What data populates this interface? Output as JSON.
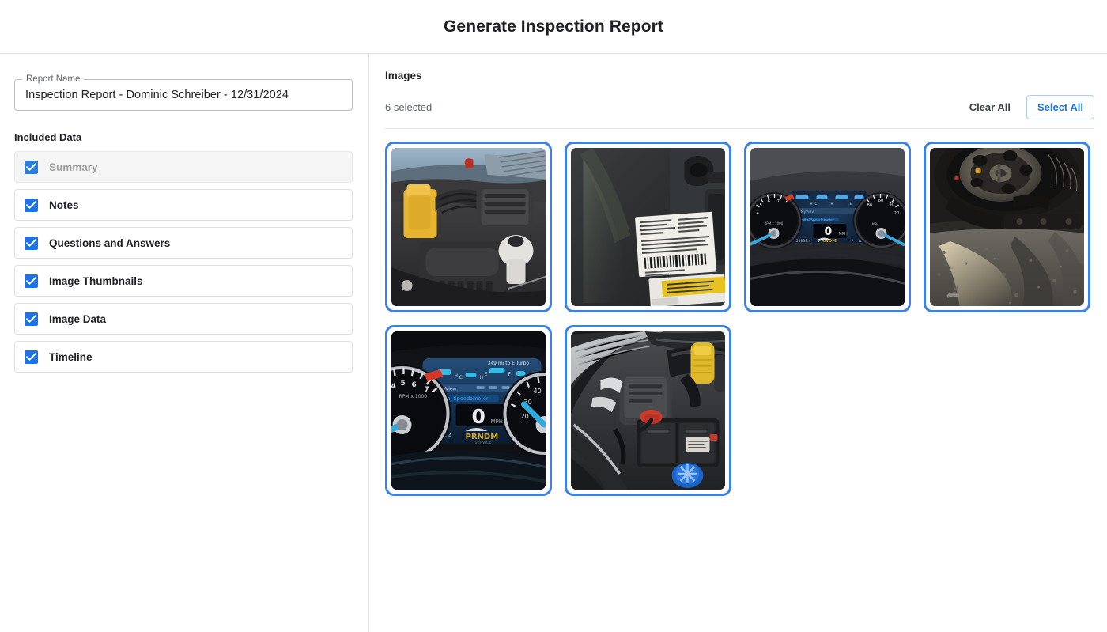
{
  "header": {
    "title": "Generate Inspection Report"
  },
  "form": {
    "report_name_label": "Report Name",
    "report_name_value": "Inspection Report - Dominic Schreiber - 12/31/2024",
    "report_name_placeholder": "Report Name"
  },
  "included_data": {
    "section_label": "Included Data",
    "items": [
      {
        "label": "Summary",
        "checked": true,
        "disabled": true
      },
      {
        "label": "Notes",
        "checked": true,
        "disabled": false
      },
      {
        "label": "Questions and Answers",
        "checked": true,
        "disabled": false
      },
      {
        "label": "Image Thumbnails",
        "checked": true,
        "disabled": false
      },
      {
        "label": "Image Data",
        "checked": true,
        "disabled": false
      },
      {
        "label": "Timeline",
        "checked": true,
        "disabled": false
      }
    ]
  },
  "images": {
    "title": "Images",
    "selected_count_text": "6 selected",
    "clear_all_label": "Clear All",
    "select_all_label": "Select All",
    "selection_color": "#3b82e8",
    "thumbnails": [
      {
        "name": "engine-bay-air-intake",
        "selected": true
      },
      {
        "name": "door-jamb-vin-label",
        "selected": true
      },
      {
        "name": "instrument-cluster-wide",
        "selected": true
      },
      {
        "name": "undercarriage-rear-wheel",
        "selected": true
      },
      {
        "name": "instrument-cluster-closeup",
        "selected": true
      },
      {
        "name": "engine-bay-battery",
        "selected": true
      }
    ]
  },
  "colors": {
    "accent": "#1a73e8",
    "selection_border": "#3b82e8",
    "text_primary": "#202124",
    "text_secondary": "#5f6368",
    "divider": "#e0e0e0"
  }
}
